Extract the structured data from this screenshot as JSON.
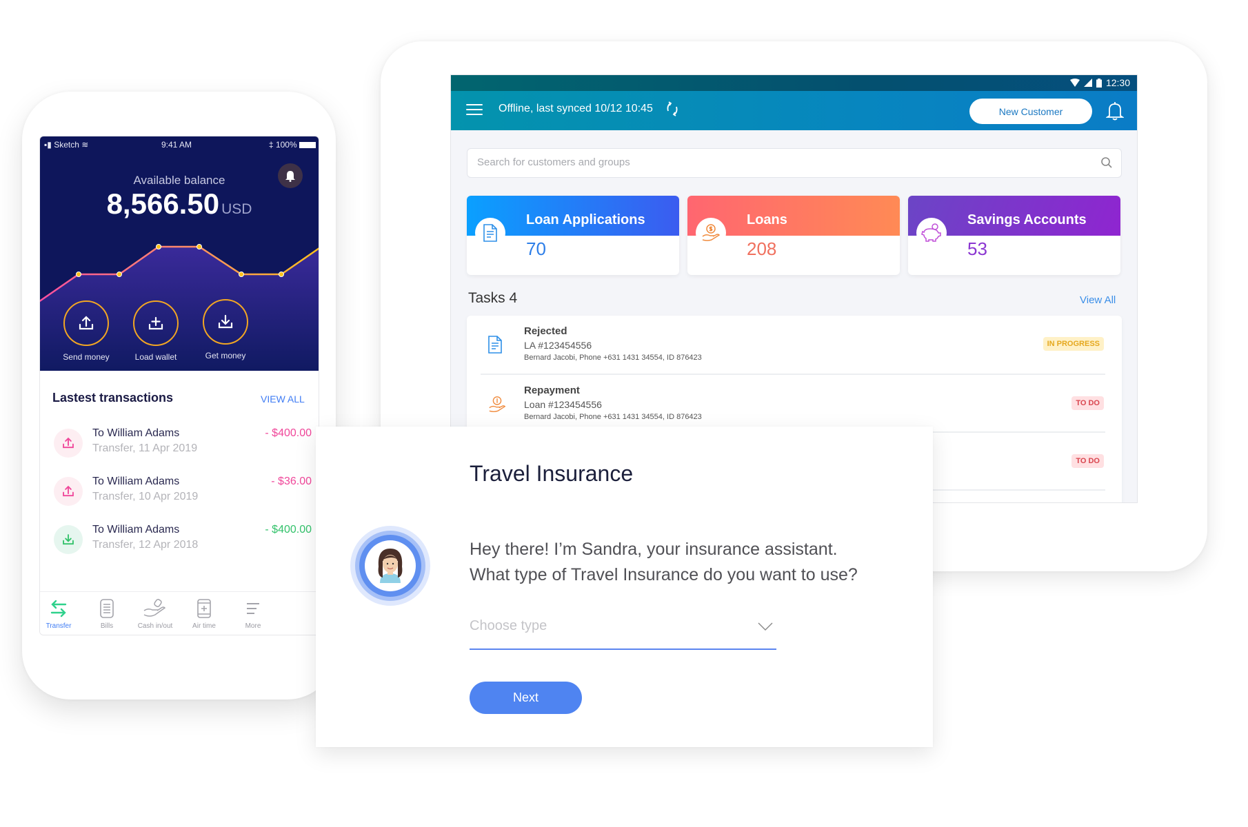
{
  "tablet": {
    "status_time": "12:30",
    "sync_status": "Offline, last synced 10/12 10:45",
    "new_customer_label": "New Customer",
    "search_placeholder": "Search for customers and groups",
    "stat_cards": [
      {
        "title": "Loan Applications",
        "value": "70",
        "icon": "document-icon",
        "color": "#2d7ee8"
      },
      {
        "title": "Loans",
        "value": "208",
        "icon": "money-hand-icon",
        "color": "#f0705e"
      },
      {
        "title": "Savings Accounts",
        "value": "53",
        "icon": "piggy-bank-icon",
        "color": "#8b37d1"
      }
    ],
    "tasks_title": "Tasks 4",
    "view_all_label": "View All",
    "tasks": [
      {
        "type": "Rejected",
        "ref": "LA #123454556",
        "details": "Bernard Jacobi, Phone +631 1431 34554, ID 876423",
        "status": "IN PROGRESS",
        "icon": "document-icon"
      },
      {
        "type": "Repayment",
        "ref": "Loan #123454556",
        "details": "Bernard Jacobi, Phone +631 1431 34554, ID 876423",
        "status": "TO DO",
        "icon": "money-hand-icon"
      },
      {
        "type": "",
        "ref": "",
        "details": "",
        "status": "TO DO",
        "icon": ""
      }
    ]
  },
  "phone": {
    "status": {
      "carrier": "Sketch",
      "time": "9:41 AM",
      "battery": "100%"
    },
    "balance_label": "Available balance",
    "balance": "8,566.50",
    "currency": "USD",
    "actions": [
      {
        "label": "Send money",
        "icon": "upload-icon"
      },
      {
        "label": "Load wallet",
        "icon": "plus-tray-icon"
      },
      {
        "label": "Get money",
        "icon": "download-icon"
      }
    ],
    "transactions_title": "Lastest transactions",
    "transactions_view_all": "VIEW ALL",
    "transactions": [
      {
        "name": "To William Adams",
        "sub": "Transfer, 11 Apr 2019",
        "amount": "- $400.00",
        "direction": "out",
        "color": "#f0479a"
      },
      {
        "name": "To William Adams",
        "sub": "Transfer, 10 Apr 2019",
        "amount": "- $36.00",
        "direction": "out",
        "color": "#f0479a"
      },
      {
        "name": "To William Adams",
        "sub": "Transfer, 12 Apr 2018",
        "amount": "- $400.00",
        "direction": "in",
        "color": "#33c26b"
      }
    ],
    "nav": [
      {
        "label": "Transfer",
        "icon": "transfer-icon",
        "active": true
      },
      {
        "label": "Bills",
        "icon": "bills-icon",
        "active": false
      },
      {
        "label": "Cash in/out",
        "icon": "cash-hand-icon",
        "active": false
      },
      {
        "label": "Air time",
        "icon": "phone-icon",
        "active": false
      },
      {
        "label": "More",
        "icon": "menu-icon",
        "active": false
      }
    ],
    "chart_data": {
      "type": "line",
      "x": [
        0,
        1,
        2,
        3,
        4,
        5,
        6,
        7
      ],
      "values": [
        1,
        2,
        2,
        3,
        3,
        2,
        2,
        3
      ],
      "title": "",
      "ylim": [
        0,
        4
      ]
    }
  },
  "insurance": {
    "title": "Travel Insurance",
    "message_line1": "Hey there! I’m Sandra, your insurance assistant.",
    "message_line2": "What type of Travel Insurance do you want to use?",
    "select_placeholder": "Choose type",
    "next_label": "Next"
  },
  "colors": {
    "phone_hero": "#0e165b",
    "accent_blue": "#4f84f1",
    "action_ring": "#f2a623",
    "tablet_appbar": "#0786bf"
  }
}
